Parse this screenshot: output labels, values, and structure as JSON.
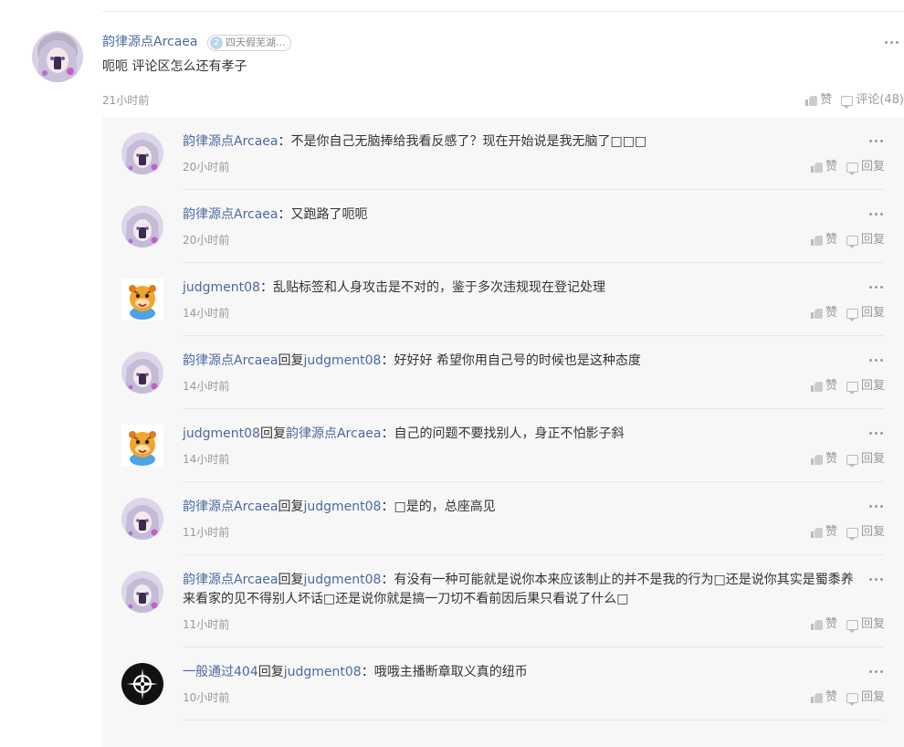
{
  "main_comment": {
    "author": "韵律源点Arcaea",
    "badge": "四天假芜湖...",
    "text": "呃呃 评论区怎么还有孝子",
    "time": "21小时前",
    "like_label": "赞",
    "comment_label": "评论(48)"
  },
  "replies": [
    {
      "author": "韵律源点Arcaea",
      "reply_word": "",
      "reply_to": "",
      "sep": "：",
      "text": "不是你自己无脑捧给我看反感了？现在开始说是我无脑了□□□",
      "time": "20小时前",
      "avatar": "anime-girl"
    },
    {
      "author": "韵律源点Arcaea",
      "reply_word": "",
      "reply_to": "",
      "sep": "：",
      "text": "又跑路了呃呃",
      "time": "20小时前",
      "avatar": "anime-girl"
    },
    {
      "author": "judgment08",
      "reply_word": "",
      "reply_to": "",
      "sep": "：",
      "text": "乱贴标签和人身攻击是不对的，鉴于多次违规现在登记处理",
      "time": "14小时前",
      "avatar": "tiger"
    },
    {
      "author": "韵律源点Arcaea",
      "reply_word": "回复",
      "reply_to": "judgment08",
      "sep": "：",
      "text": "好好好 希望你用自己号的时候也是这种态度",
      "time": "14小时前",
      "avatar": "anime-girl"
    },
    {
      "author": "judgment08",
      "reply_word": "回复",
      "reply_to": "韵律源点Arcaea",
      "sep": "：",
      "text": "自己的问题不要找别人，身正不怕影子斜",
      "time": "14小时前",
      "avatar": "tiger"
    },
    {
      "author": "韵律源点Arcaea",
      "reply_word": "回复",
      "reply_to": "judgment08",
      "sep": "：",
      "text": "□是的，总座高见",
      "time": "11小时前",
      "avatar": "anime-girl"
    },
    {
      "author": "韵律源点Arcaea",
      "reply_word": "回复",
      "reply_to": "judgment08",
      "sep": "：",
      "text": "有没有一种可能就是说你本来应该制止的并不是我的行为□还是说你其实是蜀黍养来看家的见不得别人坏话□还是说你就是搞一刀切不看前因后果只看说了什么□",
      "time": "11小时前",
      "avatar": "anime-girl"
    },
    {
      "author": "一般通过404",
      "reply_word": "回复",
      "reply_to": "judgment08",
      "sep": "：",
      "text": "哦哦主播断章取义真的纽币",
      "time": "10小时前",
      "avatar": "dark-emblem"
    }
  ],
  "reply_actions": {
    "like_label": "赞",
    "reply_label": "回复"
  },
  "colors": {
    "username": "#4a6aa0",
    "reply_bg": "#f7f7f7",
    "muted": "#999999"
  }
}
